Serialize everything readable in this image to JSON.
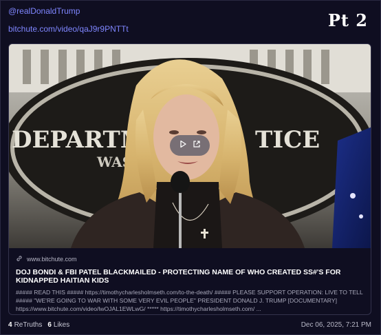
{
  "post": {
    "mention": "@realDonaldTrump",
    "link": "bitchute.com/video/qaJ9r9PNTTt",
    "badge": "Pt 2"
  },
  "card": {
    "domain": "www.bitchute.com",
    "title": "DOJ BONDI & FBI PATEL BLACKMAILED - PROTECTING NAME OF WHO CREATED SS#'S FOR KIDNAPPED HAITIAN KIDS",
    "description": "##### READ THIS ##### https://timothycharlesholmseth.com/to-the-death/ ##### PLEASE SUPPORT OPERATION: LIVE TO TELL ##### \"WE'RE GOING TO WAR WITH SOME VERY EVIL PEOPLE\" PRESIDENT DONALD J. TRUMP [DOCUMENTARY] https://www.bitchute.com/video/lwOJAL1EWLwG/ ***** https://timothycharlesholmseth.com/ ...",
    "thumbnail": {
      "backdrop_text_top": "DEPARTMENT",
      "backdrop_text_right": "TICE",
      "backdrop_text_bottom": "WAS"
    },
    "icons": [
      "link-icon",
      "play-icon",
      "external-link-icon"
    ]
  },
  "footer": {
    "retruths_count": "4",
    "retruths_label": "ReTruths",
    "likes_count": "6",
    "likes_label": "Likes",
    "timestamp": "Dec 06, 2025, 7:21 PM"
  },
  "colors": {
    "background": "#0f0e21",
    "link": "#7f86ff",
    "card_border": "#34334d"
  }
}
